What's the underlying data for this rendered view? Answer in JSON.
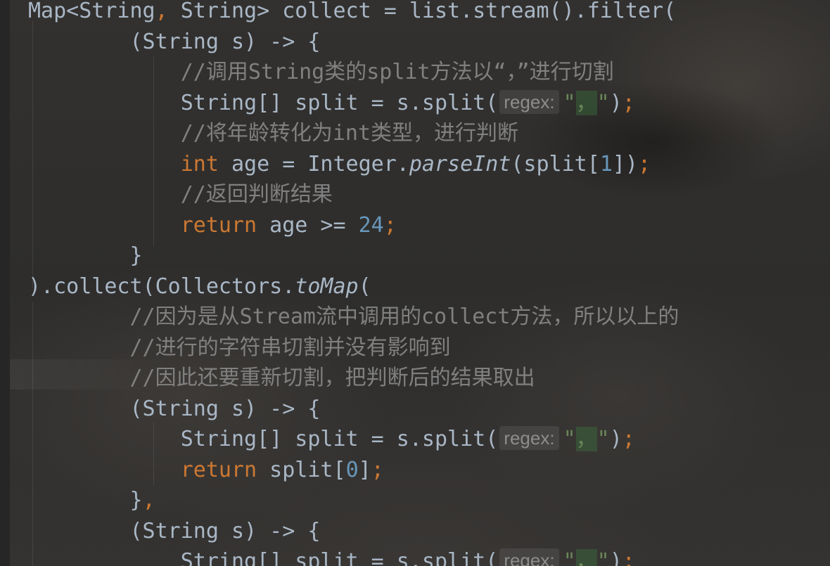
{
  "editor": {
    "language": "Java",
    "theme": "Darcula",
    "colors": {
      "keyword": "#cc7832",
      "number": "#6897bb",
      "string": "#6a8759",
      "comment": "#808080",
      "default": "#a9b7c6"
    },
    "param_hint_label": "regex:",
    "lines": [
      {
        "indent": "",
        "tokens": [
          [
            "Map<String",
            ""
          ],
          [
            ",",
            "kw"
          ],
          [
            " String> collect = list.stream().filter(",
            ""
          ]
        ]
      },
      {
        "indent": "        ",
        "tokens": [
          [
            "(String s) -> {",
            ""
          ]
        ]
      },
      {
        "indent": "            ",
        "tokens": [
          [
            "//调用String类的split方法以“，”进行切割",
            "cmt"
          ]
        ]
      },
      {
        "indent": "            ",
        "tokens": [
          [
            "String[] split = s.split(",
            ""
          ],
          [
            "@hint",
            ""
          ],
          [
            "\"",
            "str"
          ],
          [
            "，",
            "str match"
          ],
          [
            "\"",
            "str"
          ],
          [
            ")",
            ""
          ],
          [
            ";",
            "kw"
          ]
        ]
      },
      {
        "indent": "            ",
        "tokens": [
          [
            "//将年龄转化为int类型，进行判断",
            "cmt"
          ]
        ]
      },
      {
        "indent": "            ",
        "tokens": [
          [
            "int",
            "kw"
          ],
          [
            " age = Integer.",
            ""
          ],
          [
            "parseInt",
            "italic"
          ],
          [
            "(split[",
            ""
          ],
          [
            "1",
            "num"
          ],
          [
            "])",
            ""
          ],
          [
            ";",
            "kw"
          ]
        ]
      },
      {
        "indent": "            ",
        "tokens": [
          [
            "//返回判断结果",
            "cmt"
          ]
        ]
      },
      {
        "indent": "            ",
        "tokens": [
          [
            "return",
            "kw"
          ],
          [
            " age >= ",
            ""
          ],
          [
            "24",
            "num"
          ],
          [
            ";",
            "kw"
          ]
        ]
      },
      {
        "indent": "        ",
        "tokens": [
          [
            "}",
            ""
          ]
        ]
      },
      {
        "indent": "",
        "tokens": [
          [
            ").collect(Collectors.",
            ""
          ],
          [
            "toMap",
            "italic"
          ],
          [
            "(",
            ""
          ]
        ]
      },
      {
        "indent": "        ",
        "tokens": [
          [
            "//因为是从Stream流中调用的collect方法，所以以上的",
            "cmt"
          ]
        ]
      },
      {
        "indent": "        ",
        "tokens": [
          [
            "//进行的字符串切割并没有影响到",
            "cmt"
          ]
        ]
      },
      {
        "indent": "        ",
        "tokens": [
          [
            "//因此还要重新切割，把判断后的结果取出",
            "cmt"
          ]
        ]
      },
      {
        "indent": "        ",
        "tokens": [
          [
            "(String s) -> {",
            ""
          ]
        ]
      },
      {
        "indent": "            ",
        "tokens": [
          [
            "String[] split = s.split(",
            ""
          ],
          [
            "@hint",
            ""
          ],
          [
            "\"",
            "str"
          ],
          [
            "，",
            "str match"
          ],
          [
            "\"",
            "str"
          ],
          [
            ")",
            ""
          ],
          [
            ";",
            "kw"
          ]
        ]
      },
      {
        "indent": "            ",
        "tokens": [
          [
            "return",
            "kw"
          ],
          [
            " split[",
            ""
          ],
          [
            "0",
            "num"
          ],
          [
            "]",
            ""
          ],
          [
            ";",
            "kw"
          ]
        ]
      },
      {
        "indent": "        ",
        "tokens": [
          [
            "}",
            ""
          ],
          [
            ",",
            "kw"
          ]
        ]
      },
      {
        "indent": "        ",
        "tokens": [
          [
            "(String s) -> {",
            ""
          ]
        ]
      },
      {
        "indent": "            ",
        "tokens": [
          [
            "String[] split = s.split(",
            ""
          ],
          [
            "@hint",
            ""
          ],
          [
            "\"",
            "str"
          ],
          [
            "，",
            "str match"
          ],
          [
            "\"",
            "str"
          ],
          [
            ")",
            ""
          ],
          [
            ";",
            "kw"
          ]
        ]
      }
    ]
  }
}
